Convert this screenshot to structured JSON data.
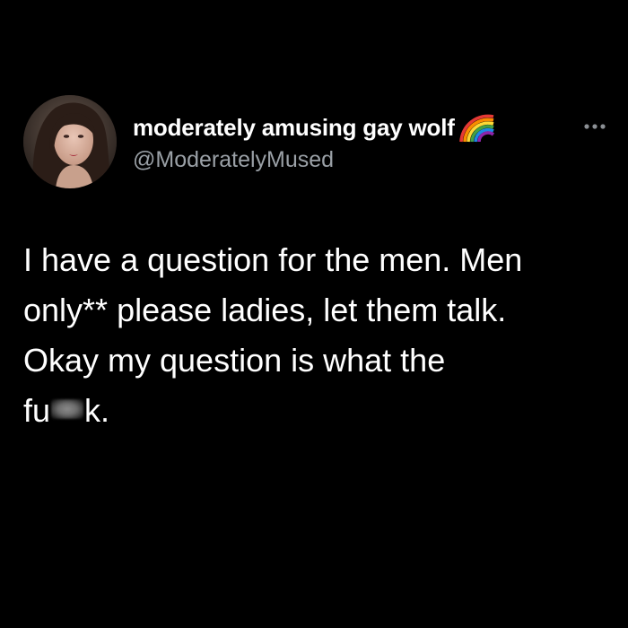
{
  "author": {
    "display_name": "moderately amusing gay wolf",
    "handle": "@ModeratelyMused",
    "name_emoji": "rainbow-emoji"
  },
  "menu": {
    "icon": "more-options-icon"
  },
  "tweet": {
    "line1": "I have a question for the men. Men",
    "line2": "only** please ladies, let them talk.",
    "line3": "Okay my question is what the",
    "line4_start": "fu",
    "line4_end": "k."
  },
  "colors": {
    "background": "#000000",
    "text": "#ffffff",
    "handle": "#9aa0a6"
  }
}
